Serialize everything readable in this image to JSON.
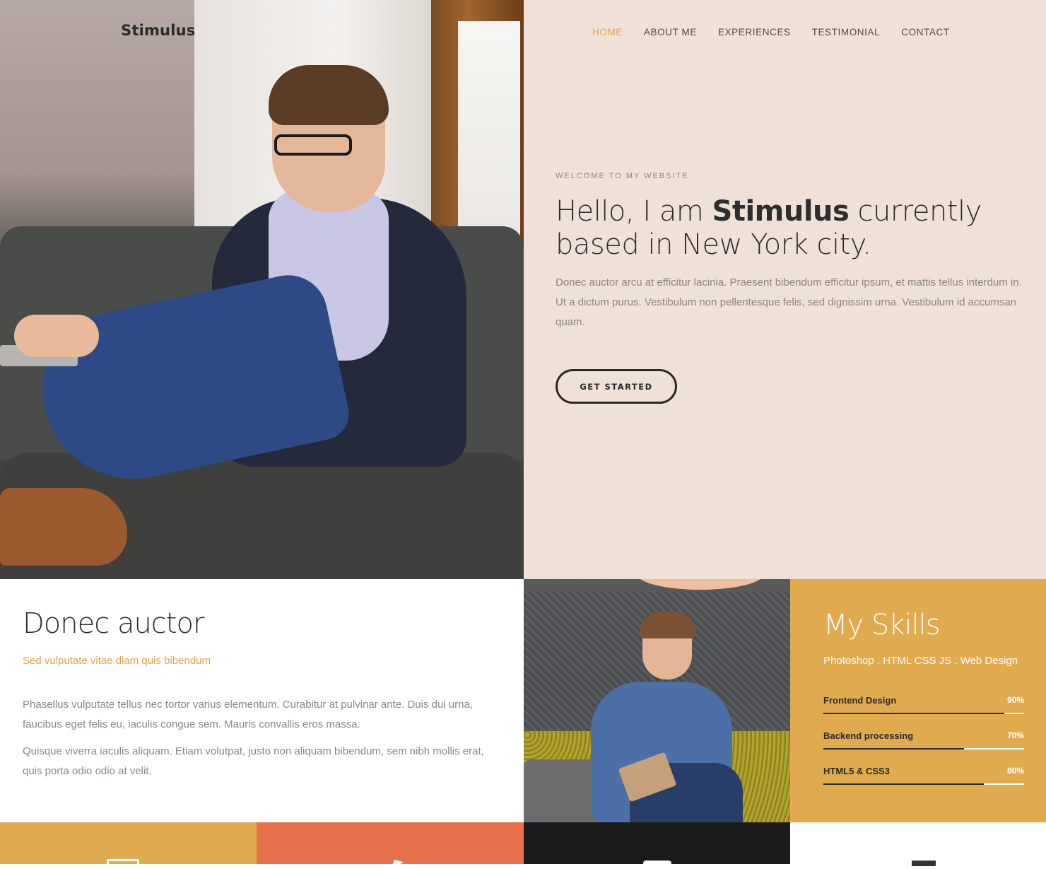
{
  "brand": {
    "logo": "Stimulus"
  },
  "nav": {
    "items": [
      {
        "label": "HOME",
        "active": true
      },
      {
        "label": "ABOUT ME",
        "active": false
      },
      {
        "label": "EXPERIENCES",
        "active": false
      },
      {
        "label": "TESTIMONIAL",
        "active": false
      },
      {
        "label": "CONTACT",
        "active": false
      }
    ]
  },
  "hero": {
    "eyebrow": "WELCOME TO MY WEBSITE",
    "headline_prefix": "Hello, I am ",
    "headline_name": "Stimulus",
    "headline_suffix": " currently based in New York city.",
    "text": "Donec auctor arcu at efficitur lacinia. Praesent bibendum efficitur ipsum, et mattis tellus interdum in. Ut a dictum purus. Vestibulum non pellentesque felis, sed dignissim urna. Vestibulum id accumsan quam.",
    "button_label": "GET STARTED"
  },
  "about": {
    "title": "Donec auctor",
    "subtitle": "Sed vulputate vitae diam quis bibendum",
    "paragraph_1": "Phasellus vulputate tellus nec tortor varius elementum. Curabitur at pulvinar ante. Duis dui urna, faucibus eget felis eu, iaculis congue sem. Mauris convallis eros massa.",
    "paragraph_2": "Quisque viverra iaculis aliquam. Etiam volutpat, justo non aliquam bibendum, sem nibh mollis erat, quis porta odio odio at velit."
  },
  "skills": {
    "title": "My Skills",
    "subtitle": "Photoshop . HTML CSS JS . Web Design",
    "items": [
      {
        "name": "Frontend Design",
        "percent_label": "90%",
        "level": 0.9
      },
      {
        "name": "Backend processing",
        "percent_label": "70%",
        "level": 0.7
      },
      {
        "name": "HTML5 & CSS3",
        "percent_label": "80%",
        "level": 0.8
      }
    ]
  },
  "colors": {
    "accent": "#e0aa4f",
    "accent_text": "#e0a34c",
    "hero_bg": "#f0e1d8",
    "tile_orange": "#e6704a",
    "tile_dark": "#1a1a1a"
  }
}
